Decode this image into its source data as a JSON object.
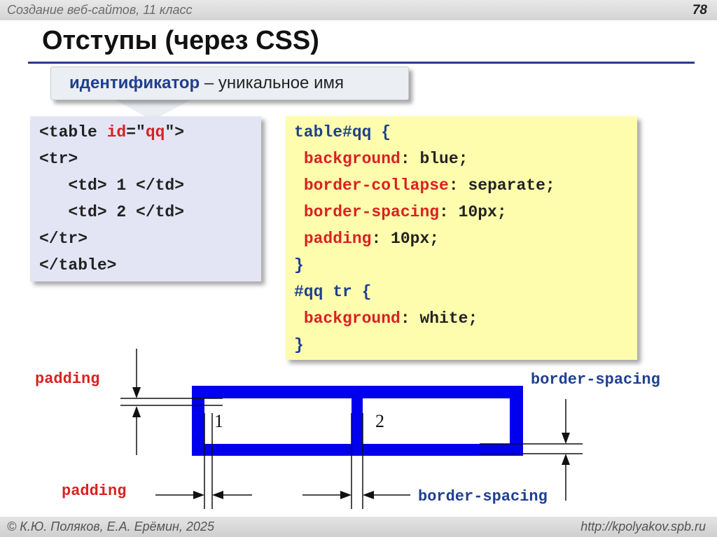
{
  "header": {
    "course": "Создание веб-сайтов, 11 класс",
    "page_number": "78"
  },
  "slide": {
    "title": "Отступы (через CSS)"
  },
  "callout": {
    "term": "идентификатор",
    "separator": " – ",
    "definition": "уникальное имя"
  },
  "html_code": {
    "line1_open": "<table ",
    "line1_attr": "id",
    "line1_eq": "=\"",
    "line1_val": "qq",
    "line1_close": "\">",
    "line2": "<tr>",
    "line3": "   <td> 1 </td>",
    "line4": "   <td> 2 </td>",
    "line5": "</tr>",
    "line6": "</table>"
  },
  "css_code": {
    "sel1": "table#qq {",
    "p1": "background",
    "v1": ": blue;",
    "p2": "border-collapse",
    "v2": ": separate;",
    "p3": "border-spacing",
    "v3": ": 10px;",
    "p4": "padding",
    "v4": ": 10px;",
    "close1": "}",
    "sel2": "#qq tr {",
    "p5": "background",
    "v5": ": white;",
    "close2": "}"
  },
  "diagram": {
    "cell1": "1",
    "cell2": "2",
    "label_padding_top": "padding",
    "label_padding_bottom": "padding",
    "label_spacing_top": "border-spacing",
    "label_spacing_bottom": "border-spacing"
  },
  "colors": {
    "red": "#d92222",
    "blue": "#1f3f8f",
    "table_blue": "#0000ee",
    "yellow": "#fdfdad",
    "lavender": "#e3e5f4"
  },
  "footer": {
    "authors": "© К.Ю. Поляков, Е.А. Ерёмин, 2025",
    "url": "http://kpolyakov.spb.ru"
  }
}
